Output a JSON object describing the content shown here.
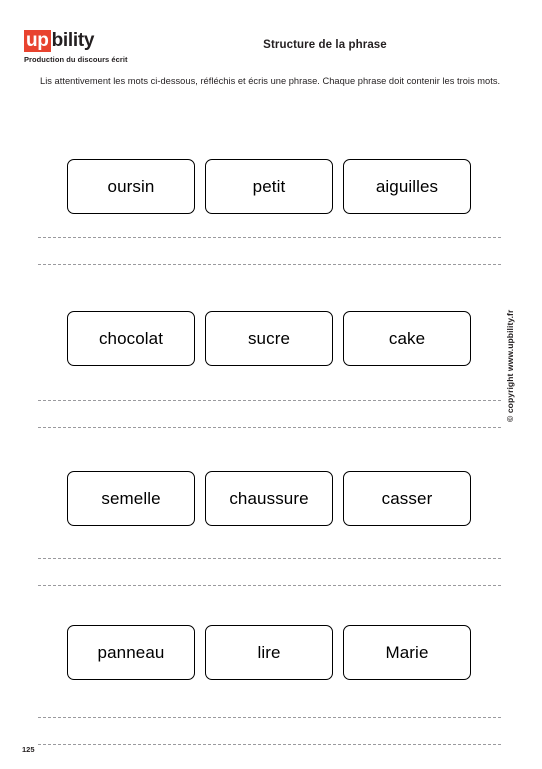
{
  "header": {
    "logo": {
      "highlight_text": "up",
      "rest_text": "bility",
      "highlight_color": "#e8432f",
      "tagline": "Production du discours écrit"
    },
    "title": "Structure de la phrase"
  },
  "instructions": "Lis attentivement les mots ci-dessous, réfléchis et écris une phrase. Chaque phrase doit contenir les trois mots.",
  "exercises": [
    {
      "words": [
        "oursin",
        "petit",
        "aiguilles"
      ],
      "answer_lines": [
        "",
        ""
      ]
    },
    {
      "words": [
        "chocolat",
        "sucre",
        "cake"
      ],
      "answer_lines": [
        "",
        ""
      ]
    },
    {
      "words": [
        "semelle",
        "chaussure",
        "casser"
      ],
      "answer_lines": [
        "",
        ""
      ]
    },
    {
      "words": [
        "panneau",
        "lire",
        "Marie"
      ],
      "answer_lines": [
        "",
        ""
      ]
    }
  ],
  "footer": {
    "copyright": "© copyright www.upbility.fr",
    "page_number": "125"
  }
}
